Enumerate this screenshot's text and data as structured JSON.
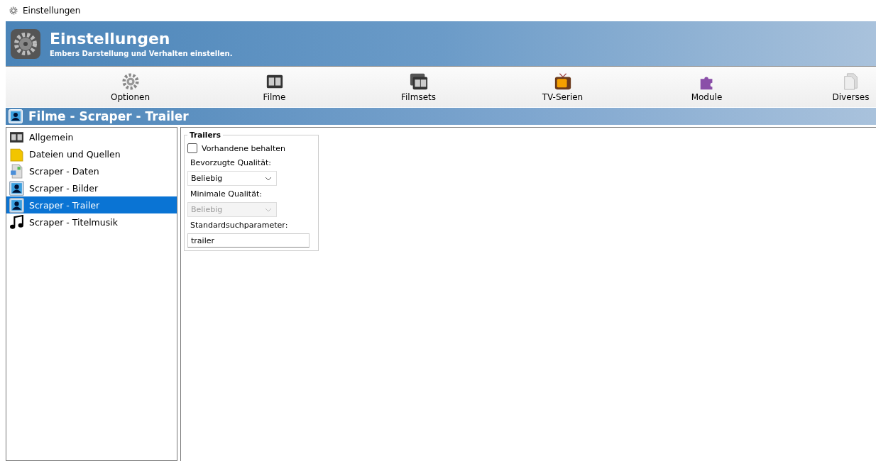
{
  "window": {
    "title": "Einstellungen"
  },
  "header": {
    "title": "Einstellungen",
    "subtitle": "Embers Darstellung und Verhalten einstellen."
  },
  "toolbar": [
    {
      "label": "Optionen",
      "kind": "gear"
    },
    {
      "label": "Filme",
      "kind": "film"
    },
    {
      "label": "Filmsets",
      "kind": "filmset"
    },
    {
      "label": "TV-Serien",
      "kind": "tv"
    },
    {
      "label": "Module",
      "kind": "puzzle"
    },
    {
      "label": "Diverses",
      "kind": "docs"
    }
  ],
  "section": {
    "title": "Filme - Scraper - Trailer"
  },
  "sidebar": {
    "items": [
      {
        "label": "Allgemein",
        "kind": "film",
        "selected": false
      },
      {
        "label": "Dateien und Quellen",
        "kind": "folder",
        "selected": false
      },
      {
        "label": "Scraper - Daten",
        "kind": "data",
        "selected": false
      },
      {
        "label": "Scraper - Bilder",
        "kind": "person",
        "selected": false
      },
      {
        "label": "Scraper - Trailer",
        "kind": "person",
        "selected": true
      },
      {
        "label": "Scraper - Titelmusik",
        "kind": "music",
        "selected": false
      }
    ]
  },
  "group": {
    "title": "Trailers",
    "checkbox": {
      "label": "Vorhandene behalten",
      "checked": false
    },
    "preferred": {
      "label": "Bevorzugte Qualität:",
      "value": "Beliebig",
      "disabled": false
    },
    "minimum": {
      "label": "Minimale Qualität:",
      "value": "Beliebig",
      "disabled": true
    },
    "search": {
      "label": "Standardsuchparameter:",
      "value": "trailer"
    }
  }
}
